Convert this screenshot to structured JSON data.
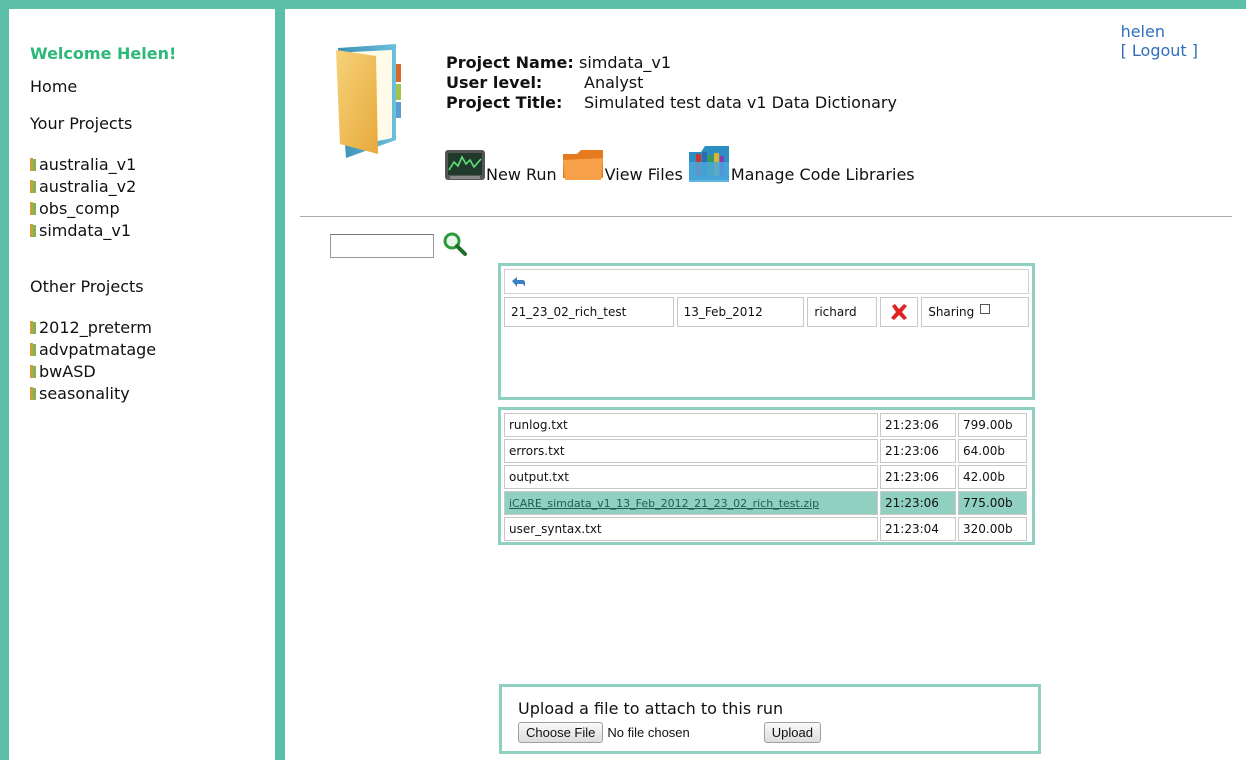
{
  "sidebar": {
    "welcome": "Welcome Helen!",
    "home": "Home",
    "your_projects_title": "Your Projects",
    "your_projects": [
      {
        "label": "australia_v1"
      },
      {
        "label": "australia_v2"
      },
      {
        "label": "obs_comp"
      },
      {
        "label": "simdata_v1"
      }
    ],
    "other_projects_title": "Other Projects",
    "other_projects": [
      {
        "label": "2012_preterm"
      },
      {
        "label": "advpatmatage"
      },
      {
        "label": "bwASD"
      },
      {
        "label": "seasonality"
      }
    ]
  },
  "user": {
    "name": "helen",
    "logout": "[ Logout ]"
  },
  "project": {
    "name_label": "Project Name:",
    "name_value": "simdata_v1",
    "level_label": "User level:",
    "level_value": "Analyst",
    "title_label": "Project Title:",
    "title_value": "Simulated test data v1 Data Dictionary"
  },
  "toolbar": {
    "new_run": "New Run",
    "view_files": "View Files",
    "manage_libraries": "Manage Code Libraries"
  },
  "search": {
    "value": ""
  },
  "run": {
    "name": "21_23_02_rich_test",
    "date": "13_Feb_2012",
    "user": "richard",
    "sharing_label": "Sharing"
  },
  "files": [
    {
      "name": "runlog.txt",
      "time": "21:23:06",
      "size": "799.00b"
    },
    {
      "name": "errors.txt",
      "time": "21:23:06",
      "size": "64.00b"
    },
    {
      "name": "output.txt",
      "time": "21:23:06",
      "size": "42.00b"
    },
    {
      "name": "iCARE_simdata_v1_13_Feb_2012_21_23_02_rich_test.zip",
      "time": "21:23:06",
      "size": "775.00b"
    },
    {
      "name": "user_syntax.txt",
      "time": "21:23:04",
      "size": "320.00b"
    }
  ],
  "upload": {
    "title": "Upload a file to attach to this run",
    "choose_label": "Choose File",
    "no_file": "No file chosen",
    "upload_label": "Upload"
  },
  "colors": {
    "frame": "#5cbfa8",
    "panel_border": "#8fd0c1",
    "welcome": "#2db87a",
    "link": "#2f6fbd"
  }
}
